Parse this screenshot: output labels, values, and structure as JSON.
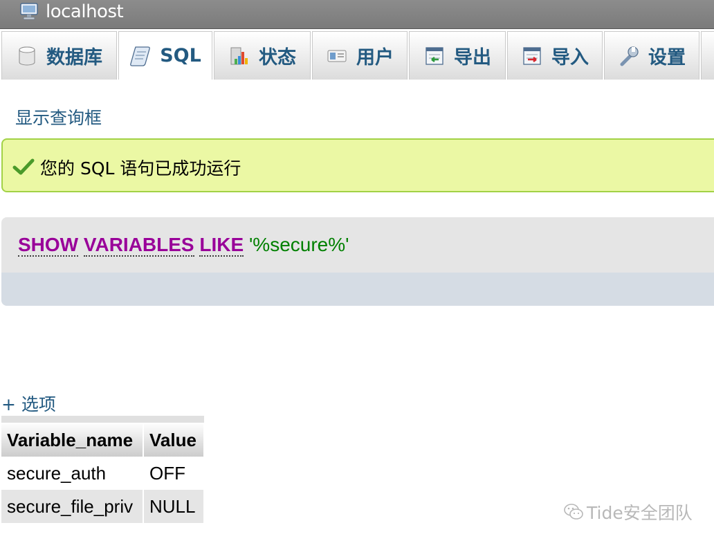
{
  "titlebar": {
    "title": "localhost",
    "icon": "server-icon"
  },
  "tabs": [
    {
      "label": "数据库",
      "icon": "database-icon",
      "active": false
    },
    {
      "label": "SQL",
      "icon": "sql-scroll-icon",
      "active": true
    },
    {
      "label": "状态",
      "icon": "status-chart-icon",
      "active": false
    },
    {
      "label": "用户",
      "icon": "users-card-icon",
      "active": false
    },
    {
      "label": "导出",
      "icon": "export-icon",
      "active": false
    },
    {
      "label": "导入",
      "icon": "import-icon",
      "active": false
    },
    {
      "label": "设置",
      "icon": "wrench-icon",
      "active": false
    }
  ],
  "show_query_link": "显示查询框",
  "success": {
    "message": "您的 SQL 语句已成功运行",
    "icon": "checkmark-icon",
    "bg_color": "#ebf8a4",
    "border_color": "#a2d246"
  },
  "sql": {
    "keyword_show": "SHOW",
    "keyword_variables": "VARIABLES",
    "keyword_like": "LIKE",
    "string_literal": "'%secure%'",
    "keyword_color": "#990099",
    "string_color": "#008000"
  },
  "options_link": "+ 选项",
  "result": {
    "headers": [
      "Variable_name",
      "Value"
    ],
    "rows": [
      [
        "secure_auth",
        "OFF"
      ],
      [
        "secure_file_priv",
        "NULL"
      ]
    ]
  },
  "watermark": {
    "text": "Tide安全团队",
    "icon": "wechat-icon"
  },
  "colors": {
    "link": "#235a81",
    "titlebar": "#7b7b7b"
  }
}
